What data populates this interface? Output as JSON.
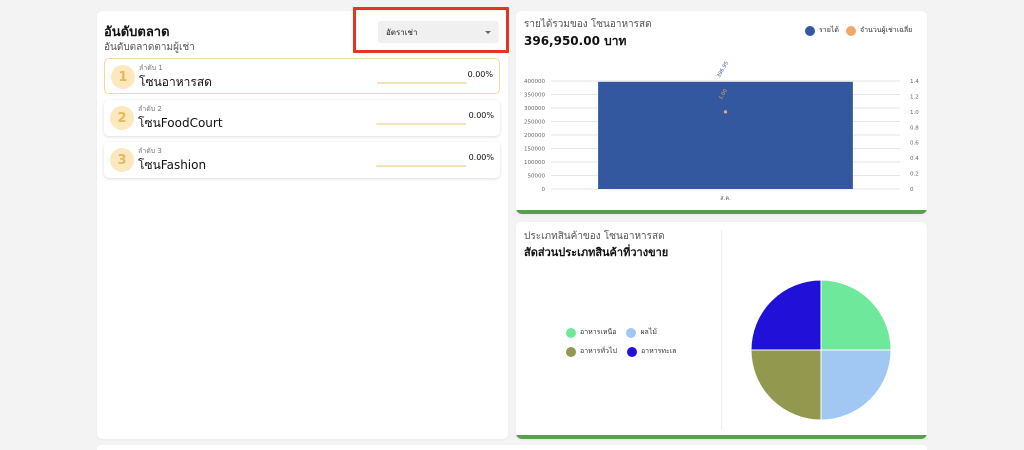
{
  "ranking": {
    "title": "อันดับตลาด",
    "subtitle": "อันดับตลาดตามผู้เช่า",
    "select": {
      "value": "อัตราเช่า"
    },
    "items": [
      {
        "badge": "1",
        "label": "ลำดับ 1",
        "name": "โซนอาหารสด",
        "percent": "0.00%"
      },
      {
        "badge": "2",
        "label": "ลำดับ 2",
        "name": "โซนFoodCourt",
        "percent": "0.00%"
      },
      {
        "badge": "3",
        "label": "ลำดับ 3",
        "name": "โซนFashion",
        "percent": "0.00%"
      }
    ]
  },
  "revenue": {
    "title": "รายได้รวมของ โซนอาหารสด",
    "total": "396,950.00 บาท",
    "legend": {
      "revenue": "รายได้",
      "tenants": "จำนวนผู้เช่าเฉลี่ย"
    }
  },
  "categories": {
    "subtitle": "ประเภทสินค้าของ โซนอาหารสด",
    "title": "สัดส่วนประเภทสินค้าที่วางขาย"
  },
  "colors": {
    "bar": "#3358a0",
    "tenant_dot": "#f0a86a",
    "accent_strip": "#5a9e4f",
    "highlight": "#e53421"
  },
  "icons": {
    "select_caret": "chevron-down-icon"
  },
  "chart_data": [
    {
      "type": "bar",
      "categories": [
        "ส.ค."
      ],
      "series": [
        {
          "name": "รายได้",
          "values": [
            396950
          ],
          "axis": "left",
          "color": "#3358a0"
        },
        {
          "name": "จำนวนผู้เช่าเฉลี่ย",
          "values": [
            1
          ],
          "axis": "right",
          "color": "#f0a86a"
        }
      ],
      "data_labels": [
        "396.95",
        "1.00"
      ],
      "ylim_left": [
        0,
        400000
      ],
      "yticks_left": [
        "0",
        "50000",
        "100000",
        "150000",
        "200000",
        "250000",
        "300000",
        "350000",
        "400000"
      ],
      "ylim_right": [
        0,
        1.4
      ],
      "yticks_right": [
        "0",
        "0.2",
        "0.4",
        "0.6",
        "0.8",
        "1.0",
        "1.2",
        "1.4"
      ],
      "grid": true
    },
    {
      "type": "pie",
      "labels": [
        "อาหารเหนือ",
        "ผลไม้",
        "อาหารทั่วไป",
        "อาหารทะเล"
      ],
      "values": [
        25,
        25,
        25,
        25
      ],
      "colors": [
        "#6ee89b",
        "#a0c8f3",
        "#92984e",
        "#2010d8"
      ],
      "legend": "left"
    }
  ]
}
